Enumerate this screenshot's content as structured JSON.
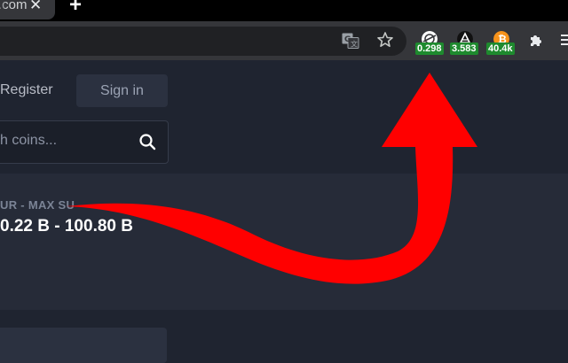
{
  "browser": {
    "tab_title": ".com",
    "tab_close_glyph": "✕",
    "new_tab_glyph": "+",
    "extensions": [
      {
        "name": "cryptocurrency-price-extension-1",
        "badge": "0.298",
        "icon": "orbit-coin-icon",
        "color": "#ffffff"
      },
      {
        "name": "cryptocurrency-price-extension-2",
        "badge": "3.583",
        "icon": "triangle-coin-icon",
        "color": "#ffffff"
      },
      {
        "name": "cryptocurrency-price-extension-3",
        "badge": "40.4k",
        "icon": "bitcoin-icon",
        "color": "#f7931a"
      }
    ],
    "badge_color": "#1e8a2e"
  },
  "header": {
    "register_label": "Register",
    "signin_label": "Sign in"
  },
  "search": {
    "placeholder": "h coins..."
  },
  "card": {
    "label": "UR - MAX SU",
    "value": "0.22 B - 100.80 B"
  },
  "annotation": {
    "arrow_color": "#ff0000"
  }
}
